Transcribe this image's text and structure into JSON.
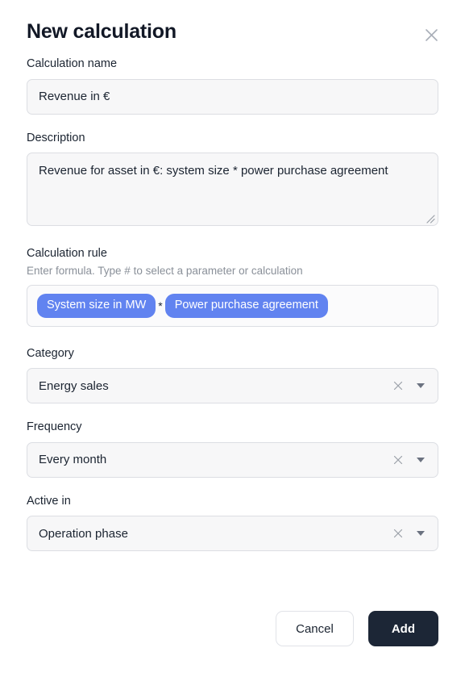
{
  "dialog": {
    "title": "New calculation",
    "close_icon": "close-icon"
  },
  "fields": {
    "name": {
      "label": "Calculation name",
      "value": "Revenue in €",
      "placeholder": "Calculation name"
    },
    "description": {
      "label": "Description",
      "value": "Revenue for asset in €: system size * power purchase agreement",
      "placeholder": "Description"
    },
    "calculation_rule": {
      "label": "Calculation rule",
      "help": "Enter formula. Type # to select a parameter or calculation",
      "tokens": [
        {
          "type": "parameter",
          "label": "System size in MW"
        },
        {
          "type": "operator",
          "label": "*"
        },
        {
          "type": "parameter",
          "label": "Power purchase agreement"
        }
      ]
    },
    "category": {
      "label": "Category",
      "value": "Energy sales",
      "clear_icon": "clear-icon",
      "caret_icon": "chevron-down-icon"
    },
    "frequency": {
      "label": "Frequency",
      "value": "Every month",
      "clear_icon": "clear-icon",
      "caret_icon": "chevron-down-icon"
    },
    "active_in": {
      "label": "Active in",
      "value": "Operation phase",
      "clear_icon": "clear-icon",
      "caret_icon": "chevron-down-icon"
    }
  },
  "footer": {
    "cancel_label": "Cancel",
    "add_label": "Add"
  },
  "colors": {
    "token_blue": "#6183f0",
    "primary_dark": "#1c2636",
    "field_bg": "#f7f7f8",
    "border": "#dcdee3",
    "text": "#1b2431",
    "muted": "#8a9099"
  }
}
